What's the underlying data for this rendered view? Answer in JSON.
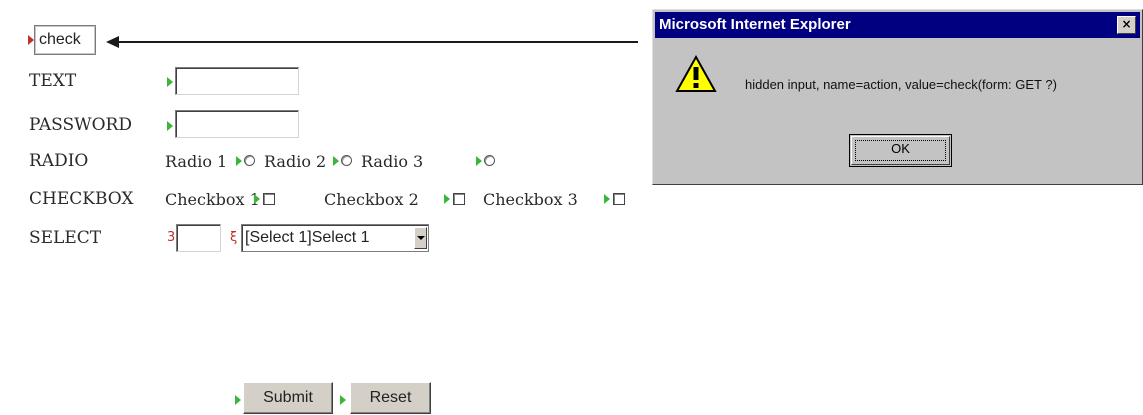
{
  "hidden_field": {
    "value": "check"
  },
  "labels": {
    "text": "TEXT",
    "password": "PASSWORD",
    "radio": "RADIO",
    "checkbox": "CHECKBOX",
    "select": "SELECT"
  },
  "inputs": {
    "text_value": "",
    "password_value": ""
  },
  "radios": [
    "Radio 1",
    "Radio 2",
    "Radio 3"
  ],
  "checkboxes": [
    "Checkbox 1",
    "Checkbox 2",
    "Checkbox 3"
  ],
  "select": {
    "text_value": "",
    "selected": "[Select 1]Select 1",
    "bracket_left": "3",
    "bracket_right": "ξ"
  },
  "buttons": {
    "submit": "Submit",
    "reset": "Reset"
  },
  "dialog": {
    "title": "Microsoft Internet Explorer",
    "close": "×",
    "message": "hidden input, name=action, value=check(form: GET ?)",
    "ok": "OK"
  },
  "colors": {
    "marker_green": "#3bb53b",
    "marker_red": "#c0302a",
    "titlebar": "#000080",
    "dialog_bg": "#c3c3c3"
  },
  "icons": {
    "dialog": "warning-icon",
    "field_marker": "marker-arrow-icon"
  }
}
